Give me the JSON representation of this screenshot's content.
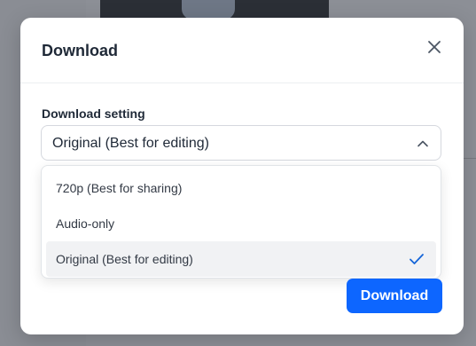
{
  "modal": {
    "title": "Download",
    "close_icon": "close-icon"
  },
  "download_setting": {
    "label": "Download setting",
    "selected_value": "Original (Best for editing)",
    "options": [
      {
        "label": "720p (Best for sharing)",
        "selected": false
      },
      {
        "label": "Audio-only",
        "selected": false
      },
      {
        "label": "Original (Best for editing)",
        "selected": true
      }
    ]
  },
  "actions": {
    "download_label": "Download"
  },
  "colors": {
    "primary": "#0d66ff",
    "checkmark": "#1565d8",
    "selected_option_bg": "#f1f2f4"
  }
}
